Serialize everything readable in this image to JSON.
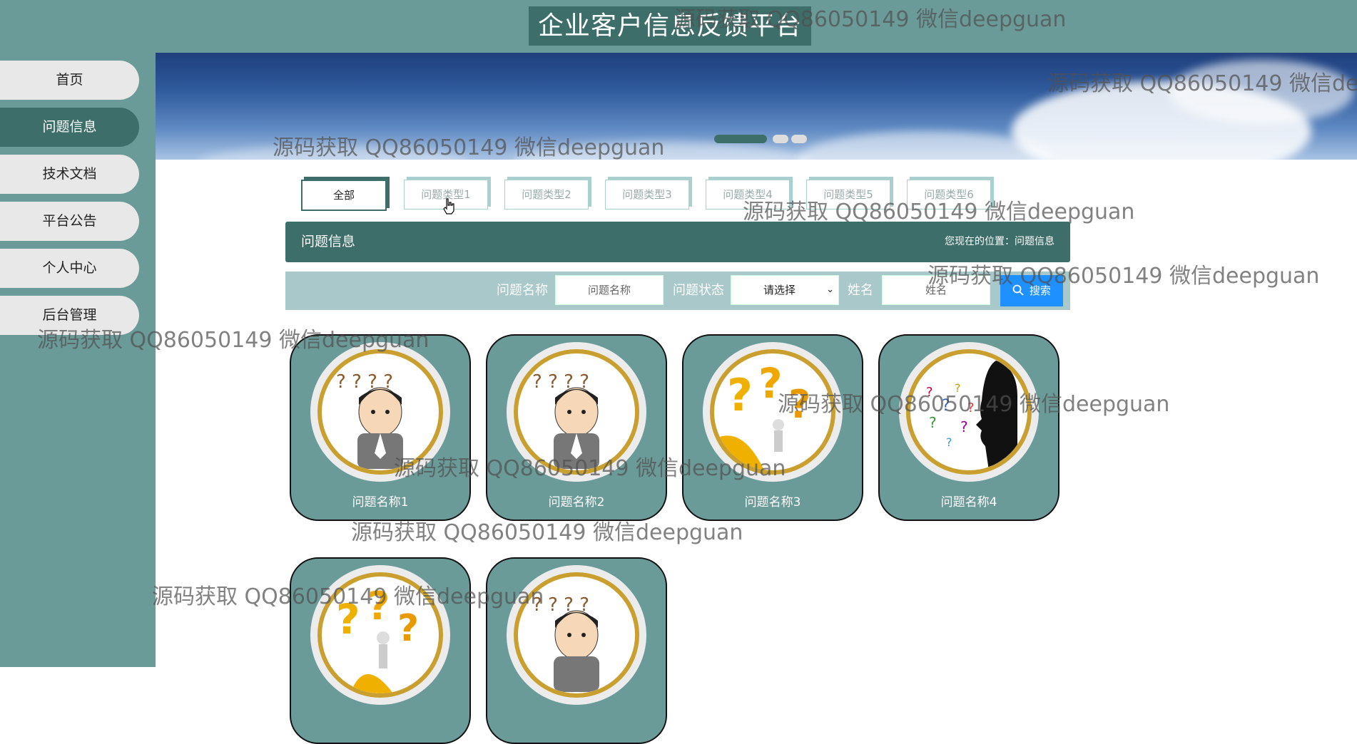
{
  "header": {
    "title": "企业客户信息反馈平台"
  },
  "sidebar": {
    "items": [
      {
        "label": "首页"
      },
      {
        "label": "问题信息",
        "active": true
      },
      {
        "label": "技术文档"
      },
      {
        "label": "平台公告"
      },
      {
        "label": "个人中心"
      },
      {
        "label": "后台管理"
      }
    ]
  },
  "category_tabs": [
    {
      "label": "全部",
      "active": true
    },
    {
      "label": "问题类型1"
    },
    {
      "label": "问题类型2"
    },
    {
      "label": "问题类型3"
    },
    {
      "label": "问题类型4"
    },
    {
      "label": "问题类型5"
    },
    {
      "label": "问题类型6"
    }
  ],
  "section": {
    "title": "问题信息",
    "breadcrumb": "您现在的位置：问题信息"
  },
  "search": {
    "name_label": "问题名称",
    "name_placeholder": "问题名称",
    "status_label": "问题状态",
    "status_selected": "请选择",
    "person_label": "姓名",
    "person_placeholder": "姓名",
    "button_label": "搜索"
  },
  "cards": [
    {
      "title": "问题名称1",
      "image": "question-man-icon"
    },
    {
      "title": "问题名称2",
      "image": "question-man-icon"
    },
    {
      "title": "问题名称3",
      "image": "question-marks-icon"
    },
    {
      "title": "问题名称4",
      "image": "silhouette-questions-icon"
    },
    {
      "title": "",
      "image": "question-marks-icon"
    },
    {
      "title": "",
      "image": "question-man-icon"
    }
  ],
  "watermark": "源码获取 QQ86050149 微信deepguan",
  "colors": {
    "primary": "#3d6e6a",
    "sidebar": "#6b9b99",
    "search_button": "#1e90ff",
    "ring": "#c9a030"
  }
}
